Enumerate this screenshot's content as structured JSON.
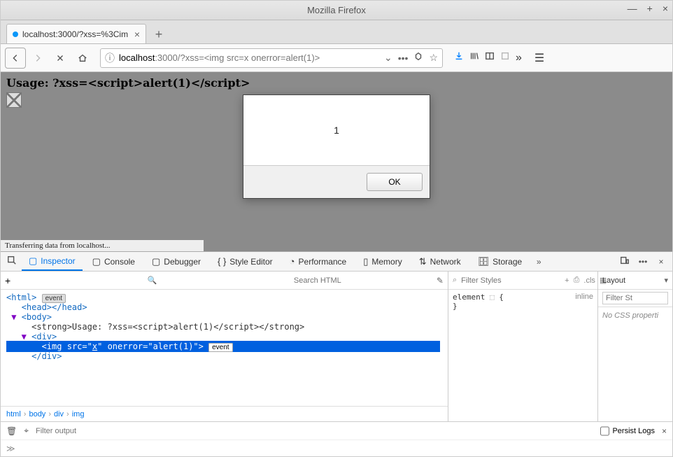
{
  "window": {
    "title": "Mozilla Firefox"
  },
  "tab": {
    "title": "localhost:3000/?xss=%3Cim"
  },
  "url": {
    "host": "localhost",
    "port": ":3000",
    "path": "/?xss=<img src=x onerror=alert(1)>"
  },
  "page": {
    "heading": "Usage: ?xss=<script>alert(1)</script>",
    "status": "Transferring data from localhost..."
  },
  "alert": {
    "message": "1",
    "ok": "OK"
  },
  "devtools": {
    "tabs": {
      "inspector": "Inspector",
      "console": "Console",
      "debugger": "Debugger",
      "style": "Style Editor",
      "perf": "Performance",
      "memory": "Memory",
      "network": "Network",
      "storage": "Storage"
    },
    "search_placeholder": "Search HTML",
    "dom": {
      "l1": "<html>",
      "l1b": "event",
      "l2": "<head></head>",
      "l3": "<body>",
      "l4": "<strong>Usage: ?xss=<script>alert(1)</script></strong>",
      "l5": "<div>",
      "l6": "<img src=\"x\" onerror=\"alert(1)\">",
      "l6b": "event",
      "l7": "</div>"
    },
    "crumbs": [
      "html",
      "body",
      "div",
      "img"
    ],
    "rules": {
      "filter_placeholder": "Filter Styles",
      "element": "element",
      "brace_open": "{",
      "brace_close": "}",
      "inline": "inline"
    },
    "layout": {
      "title": "Layout",
      "filter_placeholder": "Filter St",
      "empty": "No CSS properti"
    },
    "console": {
      "filter_placeholder": "Filter output",
      "persist": "Persist Logs",
      "prompt": "≫"
    }
  }
}
